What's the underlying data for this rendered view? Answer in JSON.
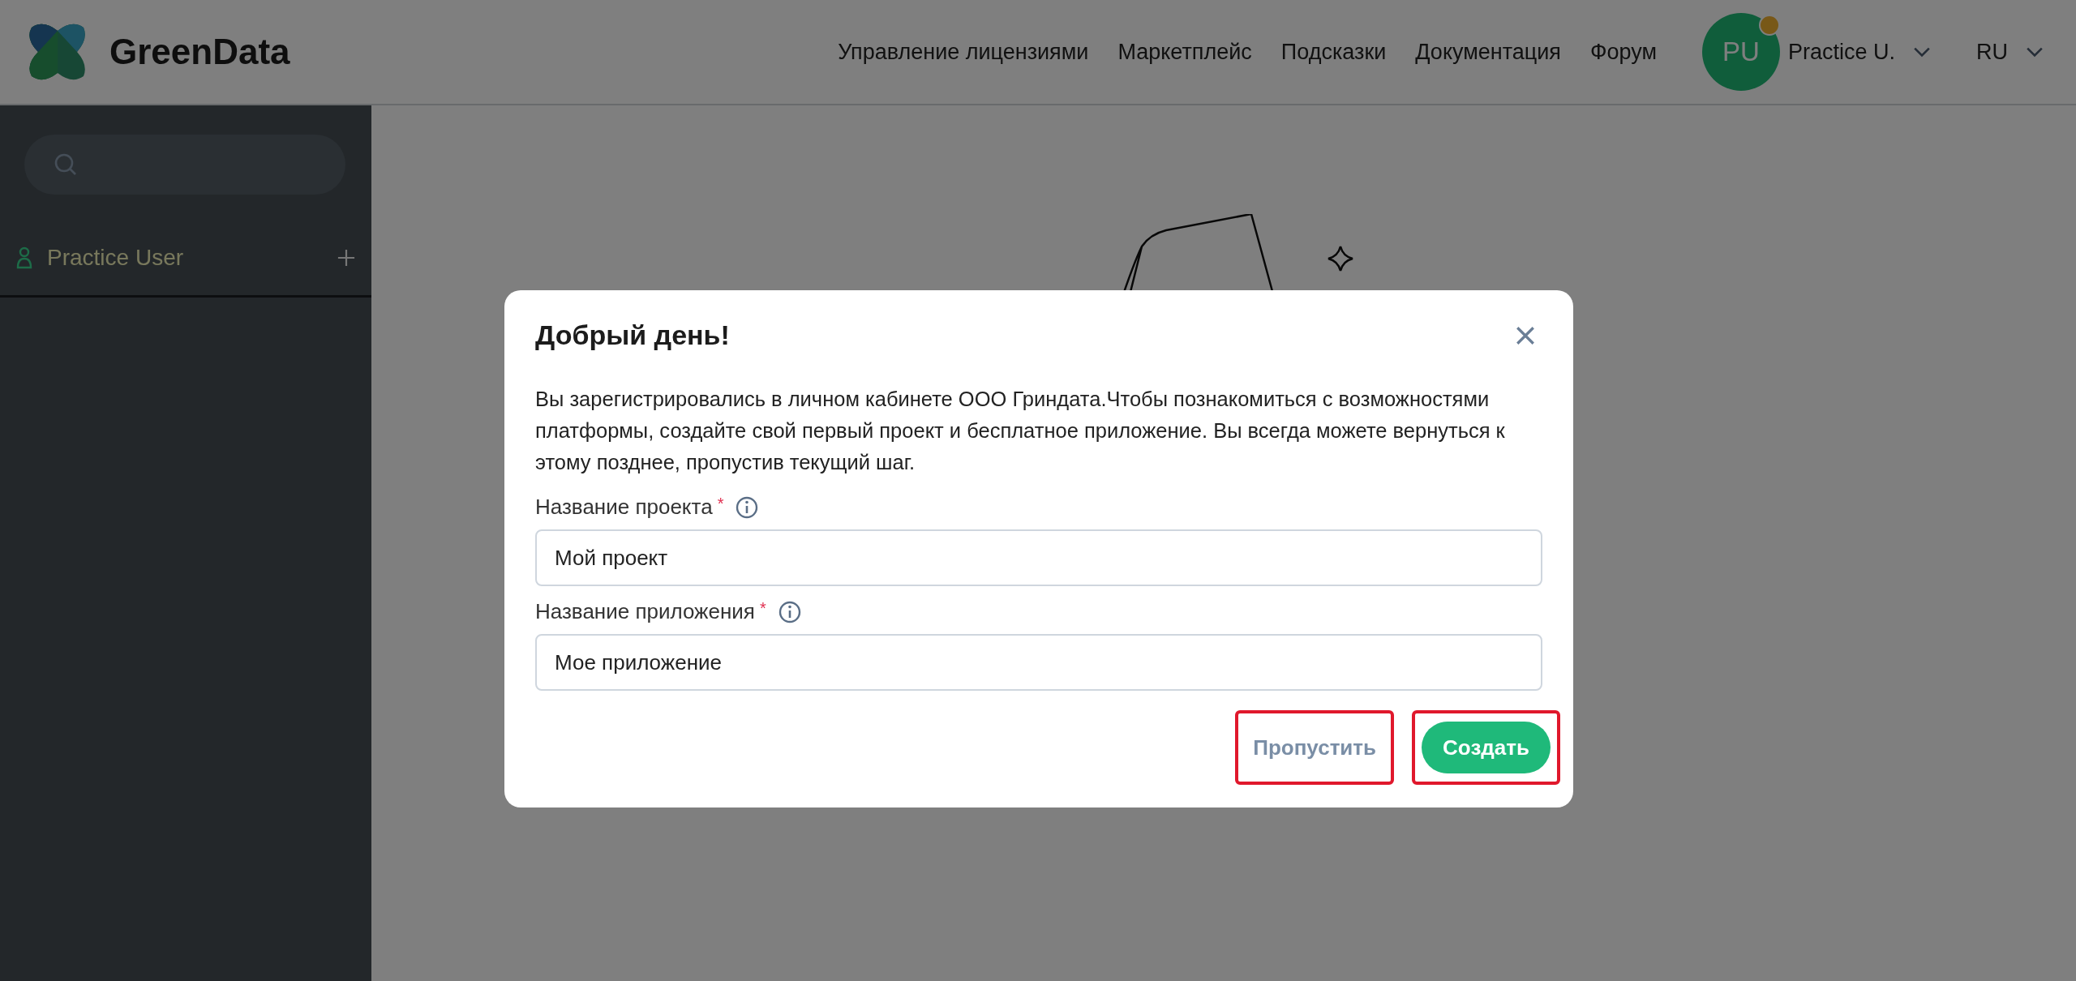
{
  "header": {
    "logo": "GreenData",
    "nav": [
      {
        "label": "Управление лицензиями"
      },
      {
        "label": "Маркетплейс"
      },
      {
        "label": "Подсказки"
      },
      {
        "label": "Документация"
      },
      {
        "label": "Форум"
      }
    ],
    "user": {
      "initials": "PU",
      "name": "Practice U.",
      "badge": true
    },
    "language": "RU"
  },
  "sidebar": {
    "items": [
      {
        "label": "Practice User"
      }
    ]
  },
  "dialog": {
    "title": "Добрый день!",
    "message": "Вы зарегистрировались в личном кабинете ООО Гриндата.Чтобы познакомиться с возможностями платформы, создайте свой первый проект и бесплатное приложение. Вы всегда можете вернуться к этому позднее, пропустив текущий шаг.",
    "fields": [
      {
        "label": "Название проекта",
        "marker": "*",
        "value": "Мой проект"
      },
      {
        "label": "Название приложения",
        "marker": "*",
        "value": "Мое приложение"
      }
    ],
    "buttons": [
      {
        "label": "Пропустить",
        "kind": "secondary",
        "highlighted": true
      },
      {
        "label": "Создать",
        "kind": "primary",
        "highlighted": true
      }
    ]
  }
}
